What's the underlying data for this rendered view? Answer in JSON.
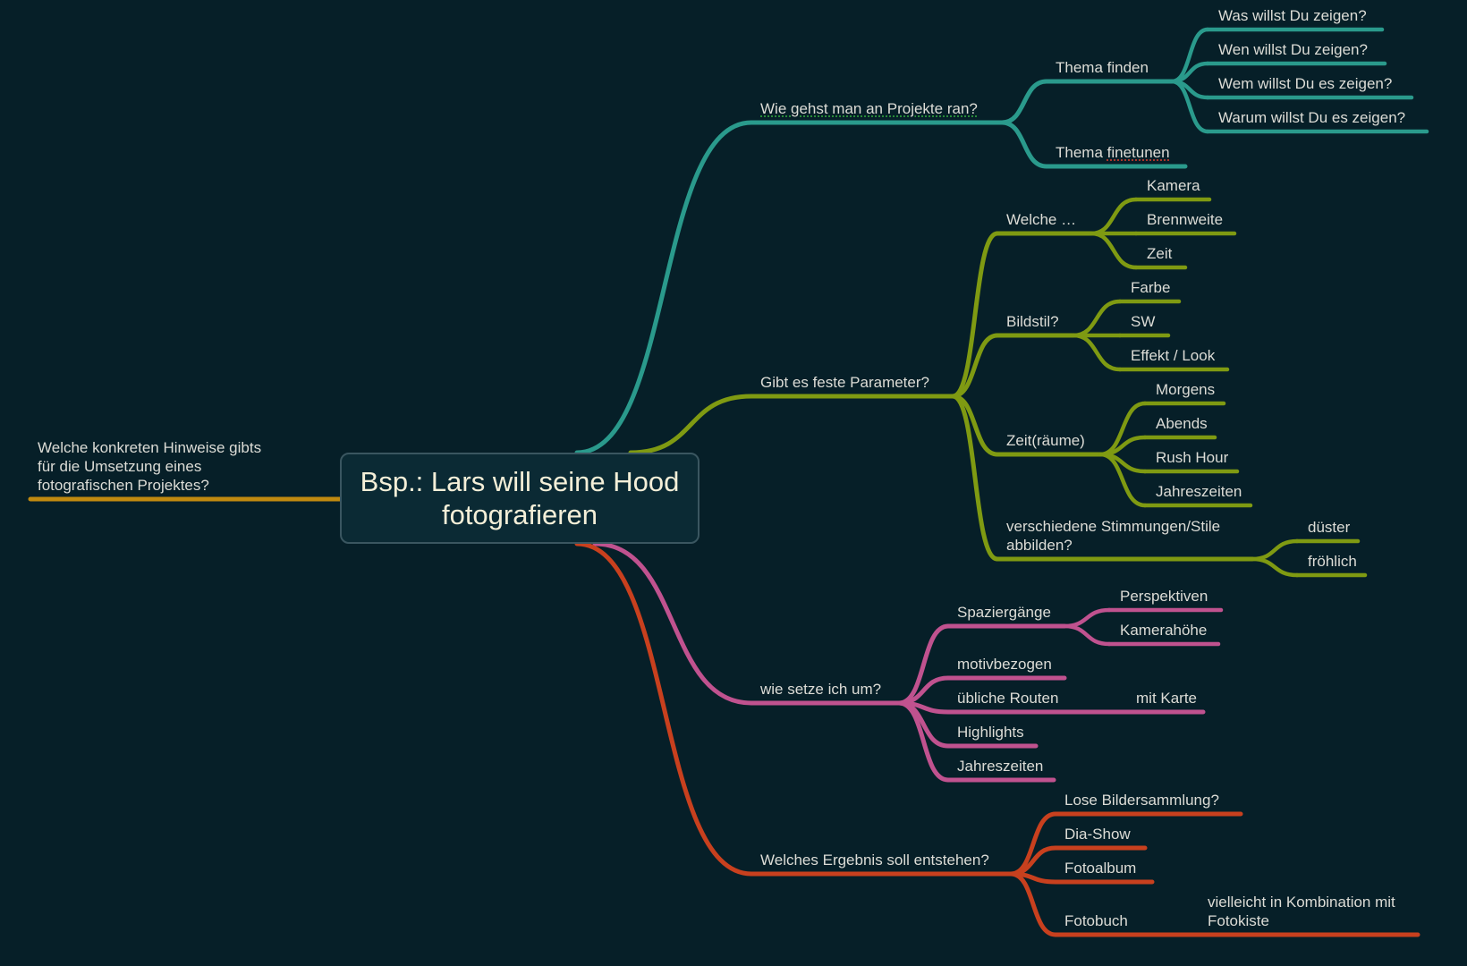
{
  "root": {
    "title": "Bsp.: Lars will seine Hood fotografieren",
    "colors": {
      "background": "#061f28",
      "box": "#0b2a34",
      "border": "#3a5660",
      "text": "#f4efd8"
    }
  },
  "colors": {
    "teal": "#2a9a8c",
    "olive": "#7f9a12",
    "pink": "#c0528f",
    "red": "#c8401e",
    "gold": "#c08a10",
    "label": "#dcdcd6"
  },
  "left_branch": {
    "label": "Welche konkreten Hinweise gibts für die Umsetzung eines fotografischen Projektes?",
    "lines": [
      "Welche konkreten Hinweise gibts",
      "für die Umsetzung eines",
      "fotografischen Projektes?"
    ],
    "color": "gold"
  },
  "branches": [
    {
      "label": "Wie gehst man an Projekte ran?",
      "color": "teal",
      "spellcheck": "green",
      "children": [
        {
          "label": "Thema finden",
          "children": [
            {
              "label": "Was willst Du zeigen?"
            },
            {
              "label": "Wen willst Du zeigen?"
            },
            {
              "label": "Wem willst Du es zeigen?"
            },
            {
              "label": "Warum willst Du es zeigen?"
            }
          ]
        },
        {
          "label": "Thema finetunen",
          "spellcheck_word": "finetunen"
        }
      ]
    },
    {
      "label": "Gibt es feste Parameter?",
      "color": "olive",
      "children": [
        {
          "label": "Welche …",
          "children": [
            {
              "label": "Kamera"
            },
            {
              "label": "Brennweite"
            },
            {
              "label": "Zeit"
            }
          ]
        },
        {
          "label": "Bildstil?",
          "children": [
            {
              "label": "Farbe"
            },
            {
              "label": "SW"
            },
            {
              "label": "Effekt / Look"
            }
          ]
        },
        {
          "label": "Zeit(räume)",
          "children": [
            {
              "label": "Morgens"
            },
            {
              "label": "Abends"
            },
            {
              "label": "Rush Hour"
            },
            {
              "label": "Jahreszeiten"
            }
          ]
        },
        {
          "label": "verschiedene Stimmungen/Stile abbilden?",
          "lines": [
            "verschiedene Stimmungen/Stile",
            "abbilden?"
          ],
          "children": [
            {
              "label": "düster"
            },
            {
              "label": "fröhlich"
            }
          ]
        }
      ]
    },
    {
      "label": "wie setze ich um?",
      "color": "pink",
      "children": [
        {
          "label": "Spaziergänge",
          "children": [
            {
              "label": "Perspektiven"
            },
            {
              "label": "Kamerahöhe"
            }
          ]
        },
        {
          "label": "motivbezogen"
        },
        {
          "label": "übliche Routen",
          "children": [
            {
              "label": "mit Karte"
            }
          ]
        },
        {
          "label": "Highlights"
        },
        {
          "label": "Jahreszeiten"
        }
      ]
    },
    {
      "label": "Welches Ergebnis soll entstehen?",
      "color": "red",
      "children": [
        {
          "label": "Lose Bildersammlung?"
        },
        {
          "label": "Dia-Show"
        },
        {
          "label": "Fotoalbum"
        },
        {
          "label": "Fotobuch",
          "children": [
            {
              "label": "vielleicht in Kombination mit Fotokiste",
              "lines": [
                "vielleicht in Kombination mit",
                "Fotokiste"
              ]
            }
          ]
        }
      ]
    }
  ]
}
